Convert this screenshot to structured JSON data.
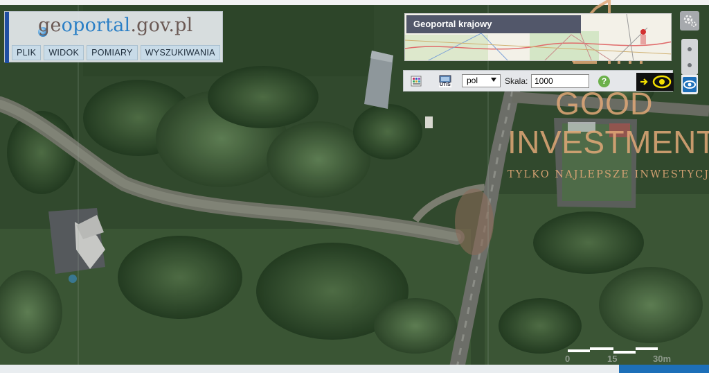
{
  "logo": {
    "part1": "ge",
    "part2": "oportal",
    "part3": ".gov.pl"
  },
  "menu": {
    "items": [
      "PLIK",
      "WIDOK",
      "POMIARY",
      "WYSZUKIWANIA"
    ]
  },
  "overview": {
    "title": "Geoportal krajowy"
  },
  "toolbar": {
    "language_value": "pol",
    "scale_label": "Skala:",
    "scale_value": "1000",
    "help_label": "?",
    "utis_label": "UTiS"
  },
  "watermark": {
    "line1": "GOOD",
    "line2": "INVESTMENT",
    "tagline": "TYLKO NAJLEPSZE INWESTYCJE"
  },
  "scalebar": {
    "labels": [
      "0",
      "15",
      "30m"
    ]
  },
  "colors": {
    "menu_bg": "#c8dbe8",
    "overview_title_bg": "#52576a",
    "watermark": "#e2a878",
    "help_green": "#6bb04a",
    "accent_blue": "#1d6fb8"
  },
  "icons": [
    "layers-icon",
    "utis-icon",
    "help-icon",
    "arrow-right-icon",
    "eye-icon",
    "gear-icon",
    "zoom-in-icon",
    "zoom-out-icon"
  ]
}
